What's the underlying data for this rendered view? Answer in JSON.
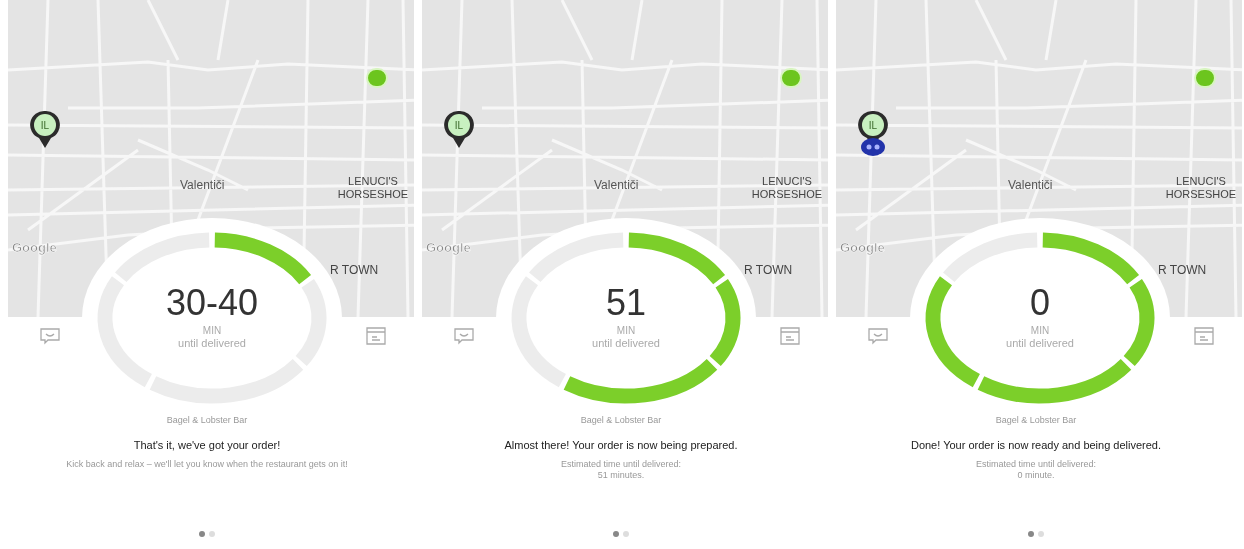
{
  "screens": [
    {
      "map": {
        "pin_label": "IL",
        "courier_marker": false,
        "labels": [
          {
            "kind": "district",
            "text": "Valentiči"
          },
          {
            "kind": "landmark",
            "text": "LENUCI'S HORSESHOE"
          },
          {
            "kind": "area",
            "text": "R TOWN"
          }
        ],
        "logo": "Google"
      },
      "progress_segments": [
        {
          "filled": true
        },
        {
          "filled": false
        },
        {
          "filled": false
        },
        {
          "filled": false
        },
        {
          "filled": false
        }
      ],
      "time": "30-40",
      "unit": "MIN",
      "caption": "until delivered",
      "restaurant": "Bagel & Lobster Bar",
      "headline": "That's it, we've got your order!",
      "details": [
        "Kick back and relax – we'll let you know when the restaurant gets on it!"
      ],
      "pages": [
        {
          "selected": true
        },
        {
          "selected": false
        }
      ]
    },
    {
      "map": {
        "pin_label": "IL",
        "courier_marker": false,
        "labels": [
          {
            "kind": "district",
            "text": "Valentiči"
          },
          {
            "kind": "landmark",
            "text": "LENUCI'S HORSESHOE"
          },
          {
            "kind": "area",
            "text": "R TOWN"
          }
        ],
        "logo": "Google"
      },
      "progress_segments": [
        {
          "filled": true
        },
        {
          "filled": true
        },
        {
          "filled": true
        },
        {
          "filled": false
        },
        {
          "filled": false
        }
      ],
      "time": "51",
      "unit": "MIN",
      "caption": "until delivered",
      "restaurant": "Bagel & Lobster Bar",
      "headline": "Almost there! Your order is now being prepared.",
      "details": [
        "Estimated time until delivered:",
        "51 minutes."
      ],
      "pages": [
        {
          "selected": true
        },
        {
          "selected": false
        }
      ]
    },
    {
      "map": {
        "pin_label": "IL",
        "courier_marker": true,
        "labels": [
          {
            "kind": "district",
            "text": "Valentiči"
          },
          {
            "kind": "landmark",
            "text": "LENUCI'S HORSESHOE"
          },
          {
            "kind": "area",
            "text": "R TOWN"
          }
        ],
        "logo": "Google"
      },
      "progress_segments": [
        {
          "filled": true
        },
        {
          "filled": true
        },
        {
          "filled": true
        },
        {
          "filled": true
        },
        {
          "filled": false
        }
      ],
      "time": "0",
      "unit": "MIN",
      "caption": "until delivered",
      "restaurant": "Bagel & Lobster Bar",
      "headline": "Done! Your order is now ready and being delivered.",
      "details": [
        "Estimated time until delivered:",
        "0 minute."
      ],
      "pages": [
        {
          "selected": true
        },
        {
          "selected": false
        }
      ]
    }
  ]
}
